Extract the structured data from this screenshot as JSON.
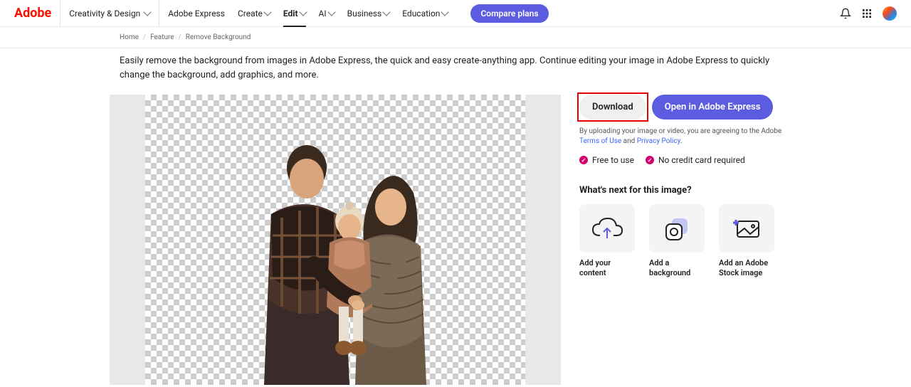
{
  "brand": "Adobe",
  "nav": {
    "creativity": "Creativity & Design",
    "express": "Adobe Express",
    "create": "Create",
    "edit": "Edit",
    "ai": "AI",
    "business": "Business",
    "education": "Education",
    "compare": "Compare plans"
  },
  "breadcrumbs": {
    "home": "Home",
    "feature": "Feature",
    "current": "Remove Background"
  },
  "intro": "Easily remove the background from images in Adobe Express, the quick and easy create-anything app. Continue editing your image in Adobe Express to quickly change the background, add graphics, and more.",
  "buttons": {
    "download": "Download",
    "open": "Open in Adobe Express"
  },
  "legal": {
    "prefix": "By uploading your image or video, you are agreeing to the Adobe ",
    "terms": "Terms of Use",
    "and": " and ",
    "privacy": "Privacy Policy",
    "suffix": "."
  },
  "perks": {
    "free": "Free to use",
    "nocard": "No credit card required"
  },
  "next_heading": "What's next for this image?",
  "cards": {
    "add_content": "Add your content",
    "add_bg": "Add a background",
    "add_stock": "Add an Adobe Stock image"
  }
}
